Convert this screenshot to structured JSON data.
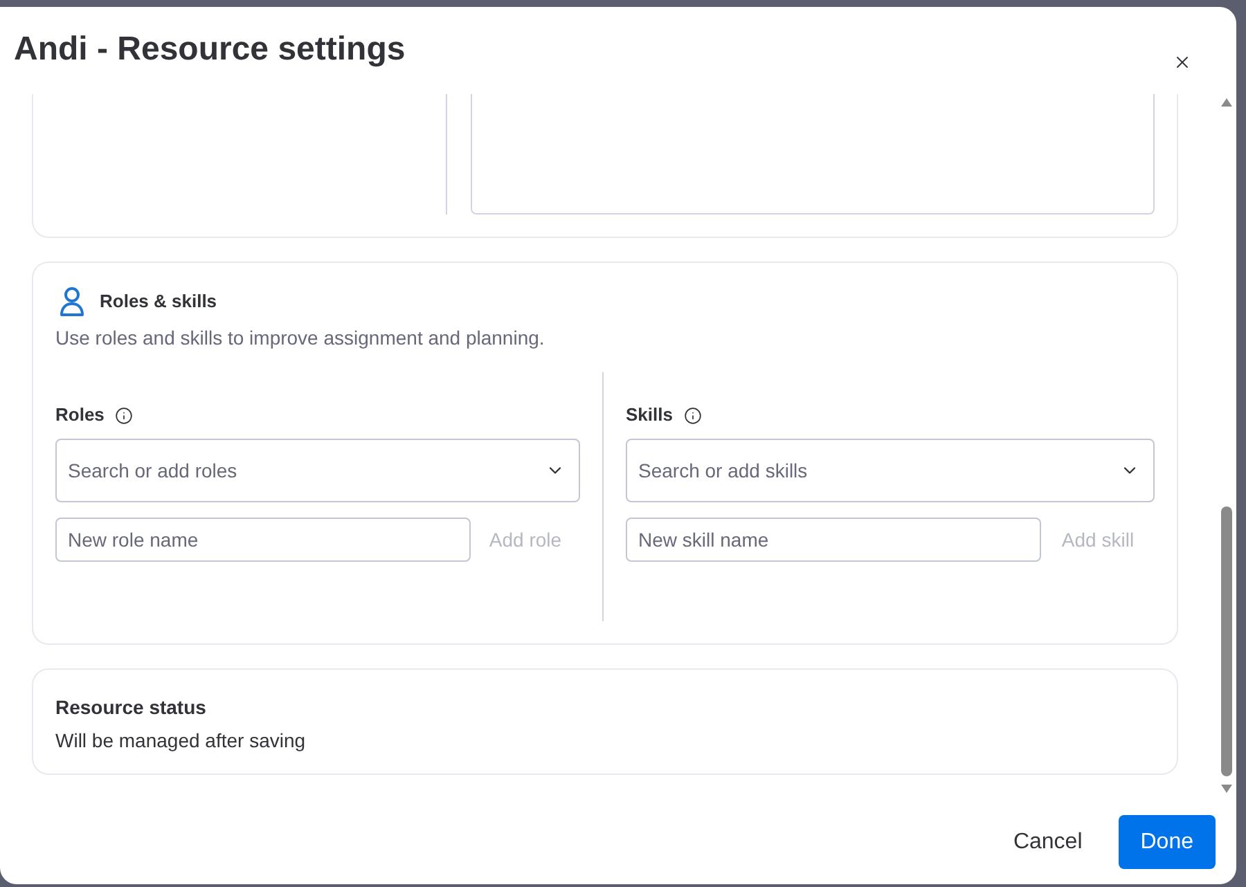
{
  "dialog": {
    "title": "Andi - Resource settings"
  },
  "roles_skills": {
    "title": "Roles & skills",
    "description": "Use roles and skills to improve assignment and planning.",
    "columns": [
      {
        "label": "Roles",
        "select_placeholder": "Search or add roles",
        "input_placeholder": "New role name",
        "button": {
          "label": "Add role",
          "disabled": true
        }
      },
      {
        "label": "Skills",
        "select_placeholder": "Search or add skills",
        "input_placeholder": "New skill name",
        "button": {
          "label": "Add skill",
          "disabled": true
        }
      }
    ]
  },
  "resource_status": {
    "title": "Resource status",
    "text": "Will be managed after saving"
  },
  "footer": {
    "buttons": [
      {
        "label": "Cancel",
        "kind": "secondary"
      },
      {
        "label": "Done",
        "kind": "primary"
      }
    ]
  }
}
